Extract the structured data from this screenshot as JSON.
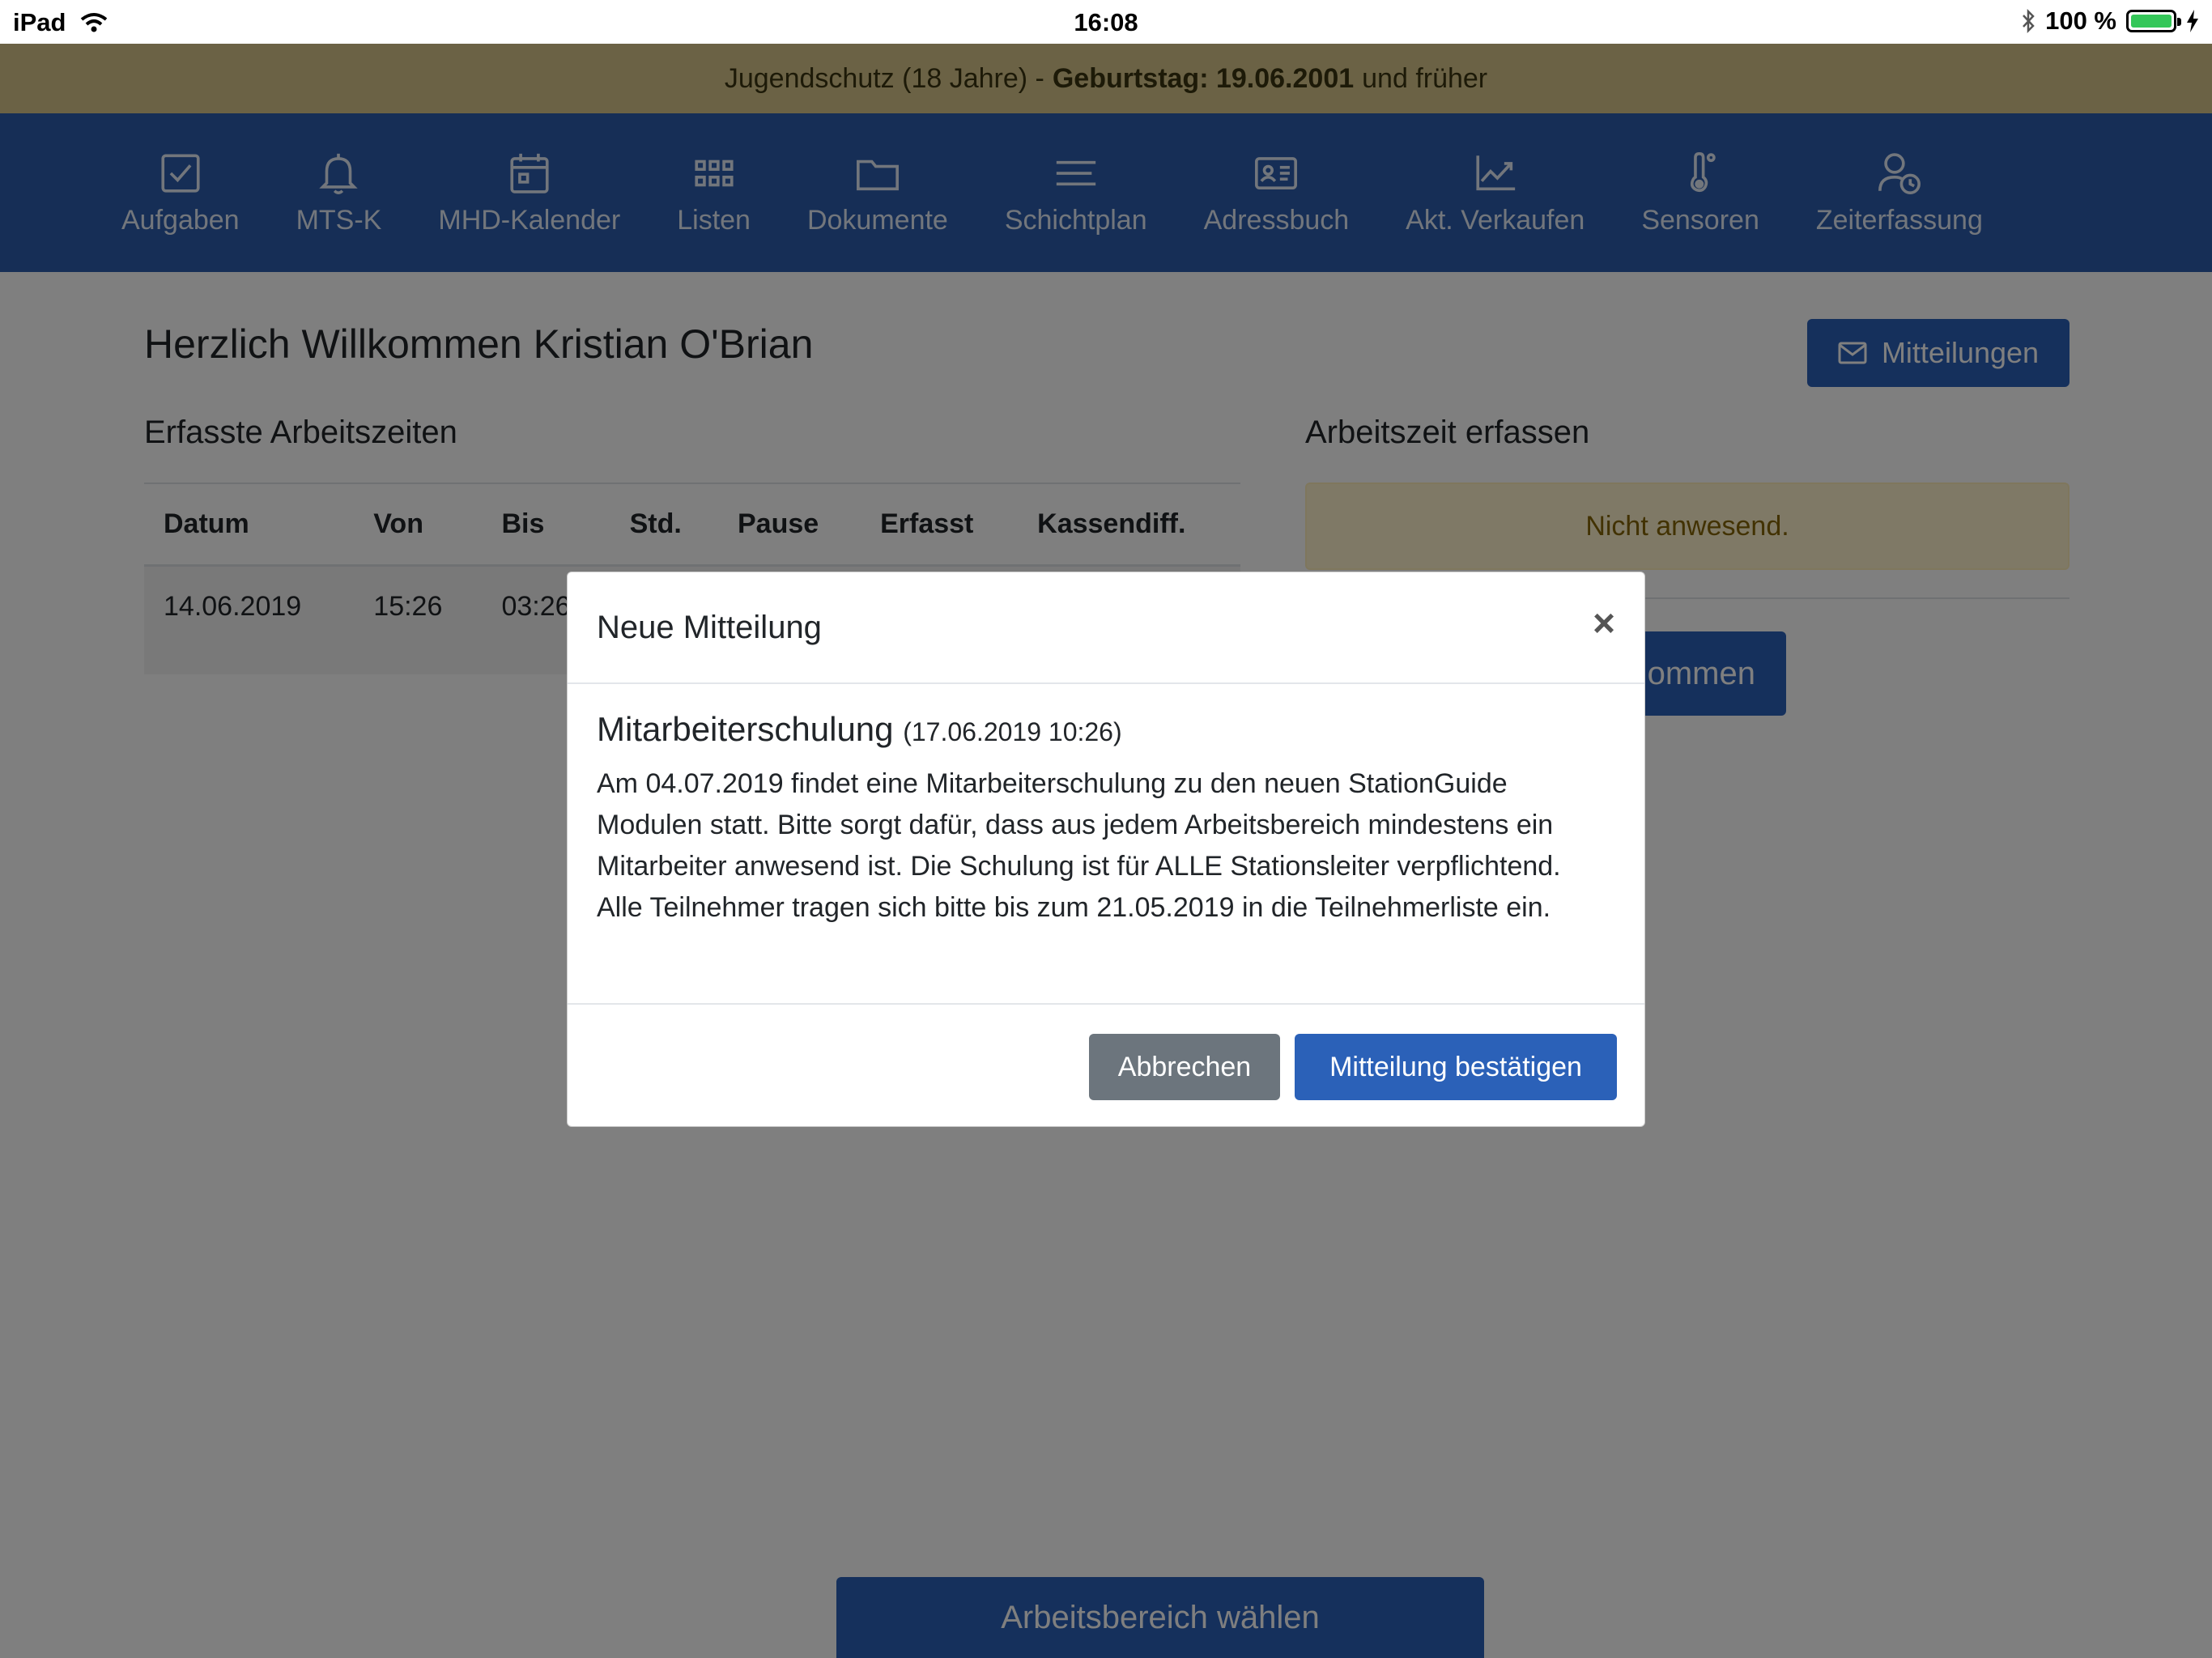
{
  "statusbar": {
    "device": "iPad",
    "time": "16:08",
    "battery": "100 %"
  },
  "banner": {
    "prefix": "Jugendschutz (18 Jahre) -",
    "birthday": "Geburtstag: 19.06.2001",
    "suffix": "und früher"
  },
  "nav": [
    {
      "label": "Aufgaben",
      "icon": "checkbox-icon"
    },
    {
      "label": "MTS-K",
      "icon": "bell-icon"
    },
    {
      "label": "MHD-Kalender",
      "icon": "calendar-icon"
    },
    {
      "label": "Listen",
      "icon": "grid-icon"
    },
    {
      "label": "Dokumente",
      "icon": "folder-icon"
    },
    {
      "label": "Schichtplan",
      "icon": "lines-icon"
    },
    {
      "label": "Adressbuch",
      "icon": "contact-card-icon"
    },
    {
      "label": "Akt. Verkaufen",
      "icon": "trend-chart-icon"
    },
    {
      "label": "Sensoren",
      "icon": "thermometer-icon"
    },
    {
      "label": "Zeiterfassung",
      "icon": "user-clock-icon"
    }
  ],
  "main": {
    "welcome": "Herzlich Willkommen Kristian O'Brian",
    "messages_button": "Mitteilungen",
    "left_heading": "Erfasste Arbeitszeiten",
    "right_heading": "Arbeitszeit erfassen",
    "table": {
      "headers": [
        "Datum",
        "Von",
        "Bis",
        "Std.",
        "Pause",
        "Erfasst",
        "Kassendiff."
      ],
      "rows": [
        [
          "14.06.2019",
          "15:26",
          "03:26",
          "",
          "",
          "",
          ""
        ]
      ]
    },
    "status_alert": "Nicht anwesend.",
    "kommen_button": "ommen",
    "area_button": "Arbeitsbereich wählen"
  },
  "modal": {
    "title": "Neue Mitteilung",
    "close": "×",
    "subject": "Mitarbeiterschulung",
    "date": "(17.06.2019 10:26)",
    "text": "Am 04.07.2019 findet eine Mitarbeiterschulung zu den neuen StationGuide Modulen statt. Bitte sorgt dafür, dass aus jedem Arbeitsbereich mindestens ein Mitarbeiter anwesend ist. Die Schulung ist für ALLE Stationsleiter verpflichtend. Alle Teilnehmer tragen sich bitte bis zum 21.05.2019 in die Teilnehmerliste ein.",
    "cancel": "Abbrechen",
    "confirm": "Mitteilung bestätigen"
  },
  "colors": {
    "primary": "#2b61b8",
    "nav": "#2c5dac",
    "banner": "#d6c58a",
    "alert": "#fff3cd",
    "secondary": "#6c757d"
  }
}
